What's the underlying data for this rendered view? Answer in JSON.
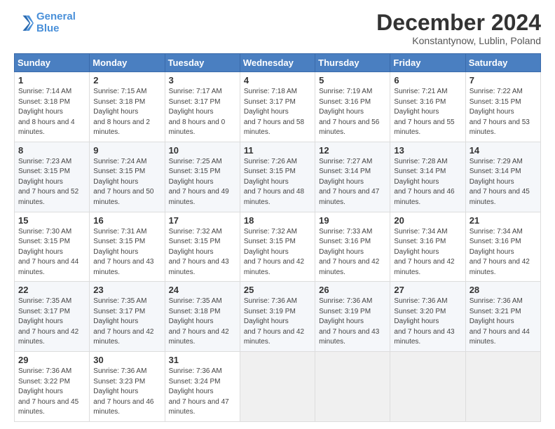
{
  "header": {
    "logo_line1": "General",
    "logo_line2": "Blue",
    "month_title": "December 2024",
    "location": "Konstantynow, Lublin, Poland"
  },
  "days_of_week": [
    "Sunday",
    "Monday",
    "Tuesday",
    "Wednesday",
    "Thursday",
    "Friday",
    "Saturday"
  ],
  "weeks": [
    [
      {
        "day": "1",
        "sunrise": "7:14 AM",
        "sunset": "3:18 PM",
        "daylight": "8 hours and 4 minutes."
      },
      {
        "day": "2",
        "sunrise": "7:15 AM",
        "sunset": "3:18 PM",
        "daylight": "8 hours and 2 minutes."
      },
      {
        "day": "3",
        "sunrise": "7:17 AM",
        "sunset": "3:17 PM",
        "daylight": "8 hours and 0 minutes."
      },
      {
        "day": "4",
        "sunrise": "7:18 AM",
        "sunset": "3:17 PM",
        "daylight": "7 hours and 58 minutes."
      },
      {
        "day": "5",
        "sunrise": "7:19 AM",
        "sunset": "3:16 PM",
        "daylight": "7 hours and 56 minutes."
      },
      {
        "day": "6",
        "sunrise": "7:21 AM",
        "sunset": "3:16 PM",
        "daylight": "7 hours and 55 minutes."
      },
      {
        "day": "7",
        "sunrise": "7:22 AM",
        "sunset": "3:15 PM",
        "daylight": "7 hours and 53 minutes."
      }
    ],
    [
      {
        "day": "8",
        "sunrise": "7:23 AM",
        "sunset": "3:15 PM",
        "daylight": "7 hours and 52 minutes."
      },
      {
        "day": "9",
        "sunrise": "7:24 AM",
        "sunset": "3:15 PM",
        "daylight": "7 hours and 50 minutes."
      },
      {
        "day": "10",
        "sunrise": "7:25 AM",
        "sunset": "3:15 PM",
        "daylight": "7 hours and 49 minutes."
      },
      {
        "day": "11",
        "sunrise": "7:26 AM",
        "sunset": "3:15 PM",
        "daylight": "7 hours and 48 minutes."
      },
      {
        "day": "12",
        "sunrise": "7:27 AM",
        "sunset": "3:14 PM",
        "daylight": "7 hours and 47 minutes."
      },
      {
        "day": "13",
        "sunrise": "7:28 AM",
        "sunset": "3:14 PM",
        "daylight": "7 hours and 46 minutes."
      },
      {
        "day": "14",
        "sunrise": "7:29 AM",
        "sunset": "3:14 PM",
        "daylight": "7 hours and 45 minutes."
      }
    ],
    [
      {
        "day": "15",
        "sunrise": "7:30 AM",
        "sunset": "3:15 PM",
        "daylight": "7 hours and 44 minutes."
      },
      {
        "day": "16",
        "sunrise": "7:31 AM",
        "sunset": "3:15 PM",
        "daylight": "7 hours and 43 minutes."
      },
      {
        "day": "17",
        "sunrise": "7:32 AM",
        "sunset": "3:15 PM",
        "daylight": "7 hours and 43 minutes."
      },
      {
        "day": "18",
        "sunrise": "7:32 AM",
        "sunset": "3:15 PM",
        "daylight": "7 hours and 42 minutes."
      },
      {
        "day": "19",
        "sunrise": "7:33 AM",
        "sunset": "3:16 PM",
        "daylight": "7 hours and 42 minutes."
      },
      {
        "day": "20",
        "sunrise": "7:34 AM",
        "sunset": "3:16 PM",
        "daylight": "7 hours and 42 minutes."
      },
      {
        "day": "21",
        "sunrise": "7:34 AM",
        "sunset": "3:16 PM",
        "daylight": "7 hours and 42 minutes."
      }
    ],
    [
      {
        "day": "22",
        "sunrise": "7:35 AM",
        "sunset": "3:17 PM",
        "daylight": "7 hours and 42 minutes."
      },
      {
        "day": "23",
        "sunrise": "7:35 AM",
        "sunset": "3:17 PM",
        "daylight": "7 hours and 42 minutes."
      },
      {
        "day": "24",
        "sunrise": "7:35 AM",
        "sunset": "3:18 PM",
        "daylight": "7 hours and 42 minutes."
      },
      {
        "day": "25",
        "sunrise": "7:36 AM",
        "sunset": "3:19 PM",
        "daylight": "7 hours and 42 minutes."
      },
      {
        "day": "26",
        "sunrise": "7:36 AM",
        "sunset": "3:19 PM",
        "daylight": "7 hours and 43 minutes."
      },
      {
        "day": "27",
        "sunrise": "7:36 AM",
        "sunset": "3:20 PM",
        "daylight": "7 hours and 43 minutes."
      },
      {
        "day": "28",
        "sunrise": "7:36 AM",
        "sunset": "3:21 PM",
        "daylight": "7 hours and 44 minutes."
      }
    ],
    [
      {
        "day": "29",
        "sunrise": "7:36 AM",
        "sunset": "3:22 PM",
        "daylight": "7 hours and 45 minutes."
      },
      {
        "day": "30",
        "sunrise": "7:36 AM",
        "sunset": "3:23 PM",
        "daylight": "7 hours and 46 minutes."
      },
      {
        "day": "31",
        "sunrise": "7:36 AM",
        "sunset": "3:24 PM",
        "daylight": "7 hours and 47 minutes."
      },
      null,
      null,
      null,
      null
    ]
  ]
}
